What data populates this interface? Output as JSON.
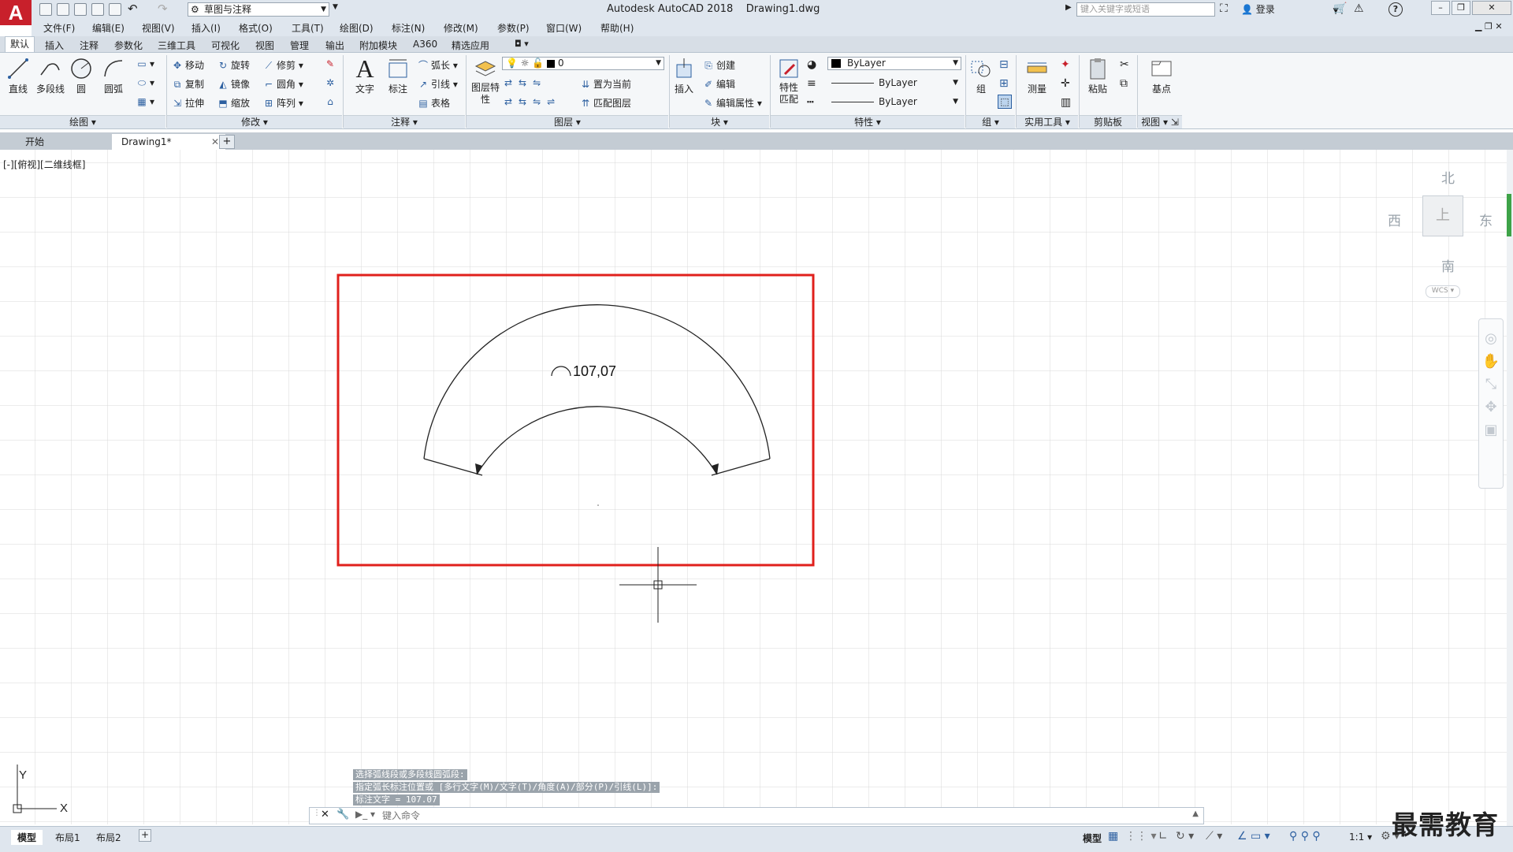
{
  "app": {
    "title": "Autodesk AutoCAD 2018",
    "document": "Drawing1.dwg",
    "logo": "A",
    "workspace": "草图与注释",
    "search_placeholder": "键入关键字或短语",
    "login": "登录",
    "help": "?"
  },
  "menus": [
    "文件(F)",
    "编辑(E)",
    "视图(V)",
    "插入(I)",
    "格式(O)",
    "工具(T)",
    "绘图(D)",
    "标注(N)",
    "修改(M)",
    "参数(P)",
    "窗口(W)",
    "帮助(H)"
  ],
  "ribbon_tabs": [
    "默认",
    "插入",
    "注释",
    "参数化",
    "三维工具",
    "可视化",
    "视图",
    "管理",
    "输出",
    "附加模块",
    "A360",
    "精选应用"
  ],
  "ribbon": {
    "draw": {
      "line": "直线",
      "polyline": "多段线",
      "circle": "圆",
      "arc": "圆弧",
      "panel": "绘图"
    },
    "modify": {
      "move": "移动",
      "rotate": "旋转",
      "trim": "修剪",
      "copy": "复制",
      "mirror": "镜像",
      "fillet": "圆角",
      "stretch": "拉伸",
      "scale": "缩放",
      "array": "阵列",
      "panel": "修改"
    },
    "annotation": {
      "text": "文字",
      "dimension": "标注",
      "arc_length": "弧长",
      "leader": "引线",
      "table": "表格",
      "panel": "注释"
    },
    "layers": {
      "layer_props": "图层特性",
      "current_layer": "0",
      "make_current": "置为当前",
      "match_layer": "匹配图层",
      "panel": "图层"
    },
    "block": {
      "insert": "插入",
      "create": "创建",
      "edit": "编辑",
      "edit_attr": "编辑属性",
      "panel": "块"
    },
    "properties": {
      "match": "特性匹配",
      "color": "ByLayer",
      "linetype": "ByLayer",
      "lineweight": "ByLayer",
      "panel": "特性"
    },
    "groups": {
      "group": "组",
      "panel": "组"
    },
    "utilities": {
      "measure": "测量",
      "panel": "实用工具"
    },
    "clipboard": {
      "paste": "粘贴",
      "panel": "剪贴板"
    },
    "view": {
      "base": "基点",
      "panel": "视图"
    }
  },
  "doc_tabs": [
    "开始",
    "Drawing1*"
  ],
  "viewport_label": "[-][俯视][二维线框]",
  "viewcube": {
    "north": "北",
    "south": "南",
    "east": "东",
    "west": "西",
    "top": "上",
    "wcs": "WCS"
  },
  "drawing": {
    "dimension_text": "107,07"
  },
  "command": {
    "history": [
      "选择弧线段或多段线圆弧段:",
      "指定弧长标注位置或 [多行文字(M)/文字(T)/角度(A)/部分(P)/引线(L)]:",
      "标注文字 = 107.07"
    ],
    "placeholder": "键入命令"
  },
  "layout_tabs": [
    "模型",
    "布局1",
    "布局2"
  ],
  "status": {
    "model": "模型",
    "scale": "1:1"
  },
  "ucs": {
    "x": "X",
    "y": "Y"
  },
  "watermark": "最需教育",
  "colors": {
    "highlight": "#e0201c",
    "logo": "#c8202b",
    "grid": "#d9d9d9"
  }
}
